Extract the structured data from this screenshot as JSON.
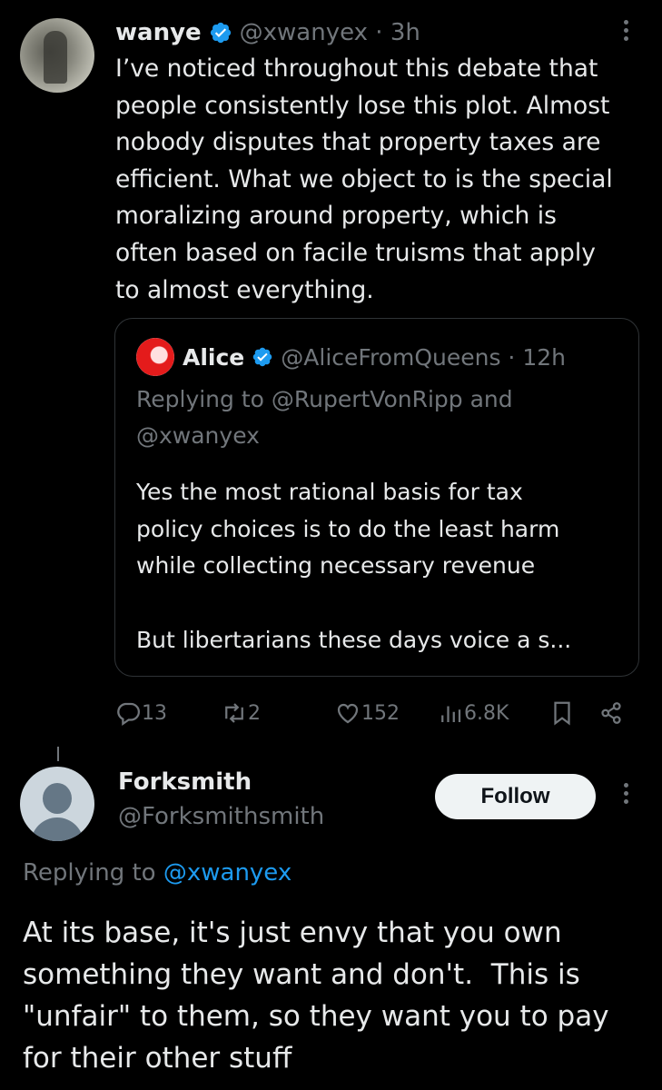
{
  "tweet1": {
    "name": "wanye",
    "handle_time": "@xwanyex · 3h",
    "text_lines": [
      "I’ve noticed throughout this debate that",
      "people consistently lose this plot. Almost",
      "nobody disputes that property taxes are",
      "efficient. What we object to is the special",
      "moralizing around property, which is",
      "often based on facile truisms that apply",
      "to almost everything."
    ],
    "quote": {
      "name": "Alice",
      "handle_time": "@AliceFromQueens · 12h",
      "reply_line1": "Replying to @RupertVonRipp and",
      "reply_line2": "@xwanyex",
      "text_lines": [
        "Yes the most rational basis for tax",
        "policy choices is to do the least harm",
        "while collecting necessary revenue"
      ],
      "text_more": "But libertarians these days voice a s..."
    },
    "actions": {
      "replies": "13",
      "reposts": "2",
      "likes": "152",
      "views": "6.8K"
    }
  },
  "tweet2": {
    "name": "Forksmith",
    "handle": "@Forksmithsmith",
    "follow_label": "Follow",
    "replying_prefix": "Replying to ",
    "replying_mention": "@xwanyex",
    "text_lines": [
      "At its base, it's just envy that you own",
      "something they want and don't.  This is",
      "\"unfair\" to them, so they want you to pay",
      "for their other stuff"
    ]
  },
  "colors": {
    "background": "#000000",
    "text": "#e7e9ea",
    "muted": "#71767b",
    "accent": "#1d9bf0",
    "border": "#2f3336"
  },
  "icons": [
    "verified-badge-icon",
    "more-options-icon",
    "reply-icon",
    "repost-icon",
    "like-icon",
    "views-icon",
    "bookmark-icon",
    "share-icon"
  ]
}
